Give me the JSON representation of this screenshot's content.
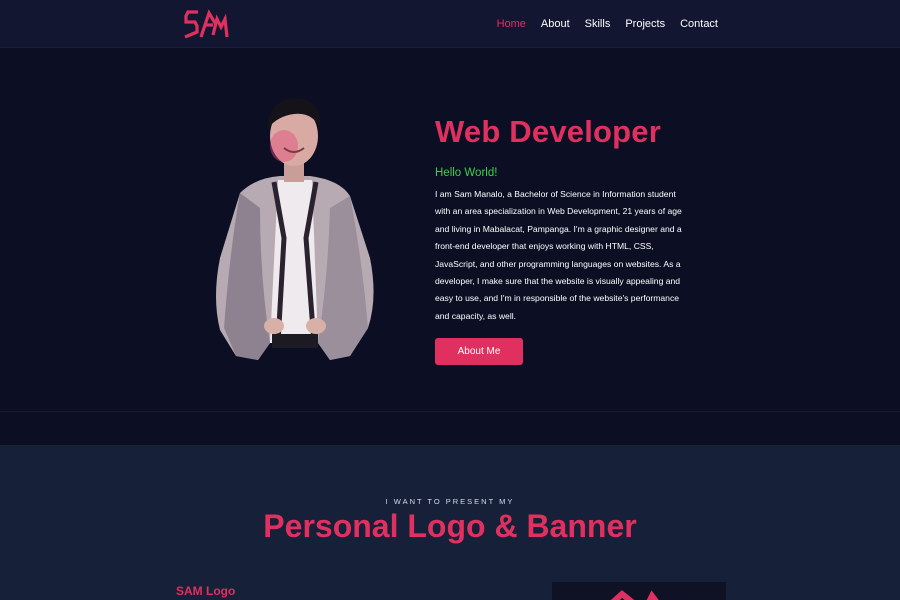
{
  "nav": {
    "logo_text": "SAM",
    "links": [
      {
        "label": "Home",
        "active": true
      },
      {
        "label": "About",
        "active": false
      },
      {
        "label": "Skills",
        "active": false
      },
      {
        "label": "Projects",
        "active": false
      },
      {
        "label": "Contact",
        "active": false
      }
    ]
  },
  "hero": {
    "title": "Web Developer",
    "greeting": "Hello World!",
    "bio": "I am Sam Manalo, a Bachelor of Science in Information student with an area specialization in Web Development, 21 years of age and living in Mabalacat, Pampanga. I'm a graphic designer and a front-end developer that enjoys working with HTML, CSS, JavaScript, and other programming languages on websites. As a developer, I make sure that the website is visually appealing and easy to use, and I'm in responsible of the website's performance and capacity, as well.",
    "button_label": "About Me"
  },
  "logo_section": {
    "kicker": "I WANT TO PRESENT MY",
    "title": "Personal Logo & Banner",
    "sam_logo_label": "SAM Logo"
  },
  "colors": {
    "accent": "#e0305f",
    "greeting": "#3ecf4a",
    "nav_bg": "#121631",
    "hero_bg": "#0c0f24",
    "section_bg": "#162038"
  }
}
